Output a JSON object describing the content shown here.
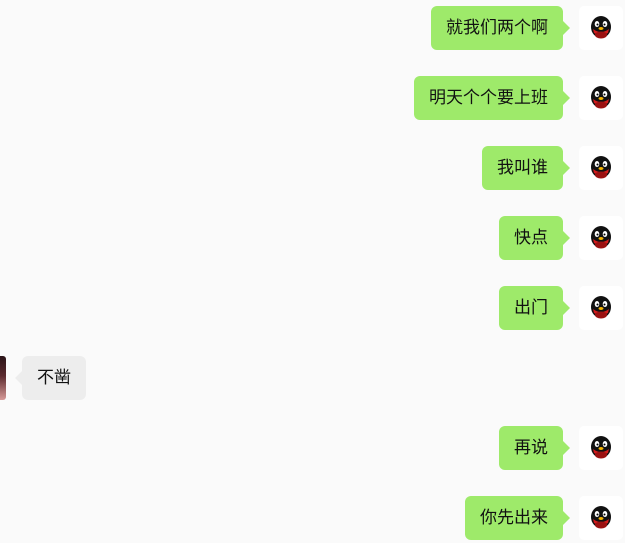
{
  "colors": {
    "background": "#fafafa",
    "outgoing_bubble": "#9eea6a",
    "incoming_bubble": "#ededed"
  },
  "icons": {
    "own_avatar": "penguin-avatar-icon",
    "other_avatar": "contact-avatar-icon"
  },
  "messages": [
    {
      "side": "out",
      "text": "就我们两个啊"
    },
    {
      "side": "out",
      "text": "明天个个要上班"
    },
    {
      "side": "out",
      "text": "我叫谁"
    },
    {
      "side": "out",
      "text": "快点"
    },
    {
      "side": "out",
      "text": "出门"
    },
    {
      "side": "in",
      "text": "不凿"
    },
    {
      "side": "out",
      "text": "再说"
    },
    {
      "side": "out",
      "text": "你先出来"
    }
  ]
}
